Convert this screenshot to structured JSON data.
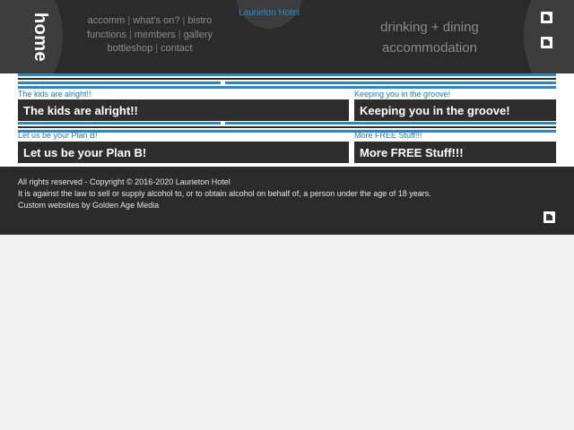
{
  "header": {
    "home_label": "home",
    "site_link": "Laurieton Hotel",
    "nav": {
      "row1": [
        "accomm",
        "what's on?",
        "bistro"
      ],
      "row2": [
        "functions",
        "members",
        "gallery"
      ],
      "row3": [
        "bottleshop",
        "contact"
      ]
    },
    "tagline_line1": "drinking + dining",
    "tagline_line2": "accommodation",
    "social_icons": [
      "facebook-icon",
      "instagram-icon"
    ]
  },
  "cards": [
    {
      "label": "The kids are alright!!",
      "title": "The kids are alright!!"
    },
    {
      "label": "Keeping you in the groove!",
      "title": "Keeping you in the groove!"
    },
    {
      "label": "Let us be your Plan B!",
      "title": "Let us be your Plan B!"
    },
    {
      "label": "More FREE Stuff!!!",
      "title": "More FREE Stuff!!!"
    }
  ],
  "footer": {
    "copyright": "All rights reserved - Copyright © 2016-2020 Laurieton Hotel",
    "alcohol_notice": "It is against the law to sell or supply alcohol to, or to obtain alcohol on behalf of, a person under the age of 18 years.",
    "credit": "Custom websites by Golden Age Media",
    "social_icon": "facebook-icon"
  },
  "colors": {
    "header_bg": "#2b2b2b",
    "accent_blue": "#2a87c1",
    "link_blue": "#1a7cc0",
    "card_bar": "#2d2d2d",
    "page_bg": "#f1f1f1"
  }
}
